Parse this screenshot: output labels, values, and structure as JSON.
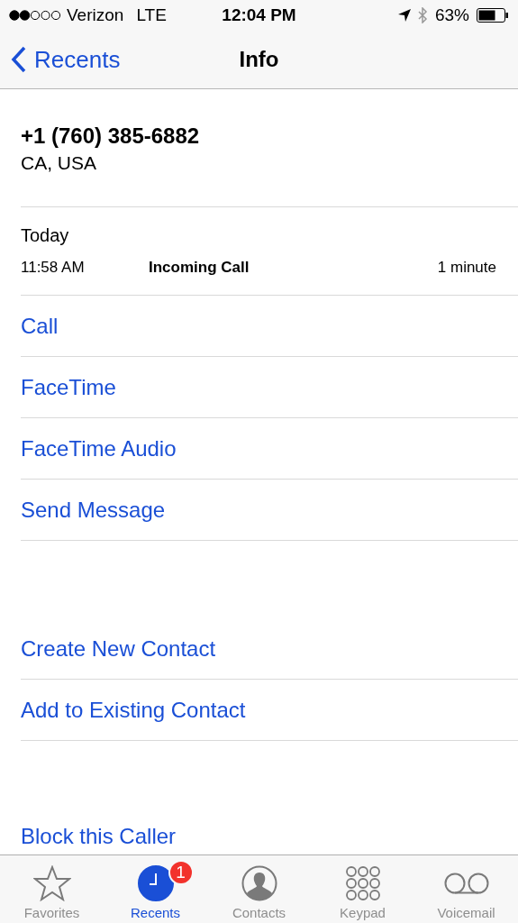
{
  "status_bar": {
    "carrier": "Verizon",
    "network": "LTE",
    "time": "12:04 PM",
    "battery": "63%"
  },
  "nav": {
    "back": "Recents",
    "title": "Info"
  },
  "caller": {
    "number": "+1 (760) 385-6882",
    "location": "CA, USA"
  },
  "history": {
    "day": "Today",
    "entries": [
      {
        "time": "11:58 AM",
        "type": "Incoming Call",
        "duration": "1 minute"
      }
    ]
  },
  "actions": [
    {
      "label": "Call"
    },
    {
      "label": "FaceTime"
    },
    {
      "label": "FaceTime Audio"
    },
    {
      "label": "Send Message"
    }
  ],
  "contact_actions": [
    {
      "label": "Create New Contact"
    },
    {
      "label": "Add to Existing Contact"
    }
  ],
  "block_action": {
    "label": "Block this Caller"
  },
  "tabs": [
    {
      "kind": "favorites",
      "label": "Favorites",
      "selected": false
    },
    {
      "kind": "recents",
      "label": "Recents",
      "selected": true,
      "badge": "1"
    },
    {
      "kind": "contacts",
      "label": "Contacts",
      "selected": false
    },
    {
      "kind": "keypad",
      "label": "Keypad",
      "selected": false
    },
    {
      "kind": "voicemail",
      "label": "Voicemail",
      "selected": false
    }
  ]
}
